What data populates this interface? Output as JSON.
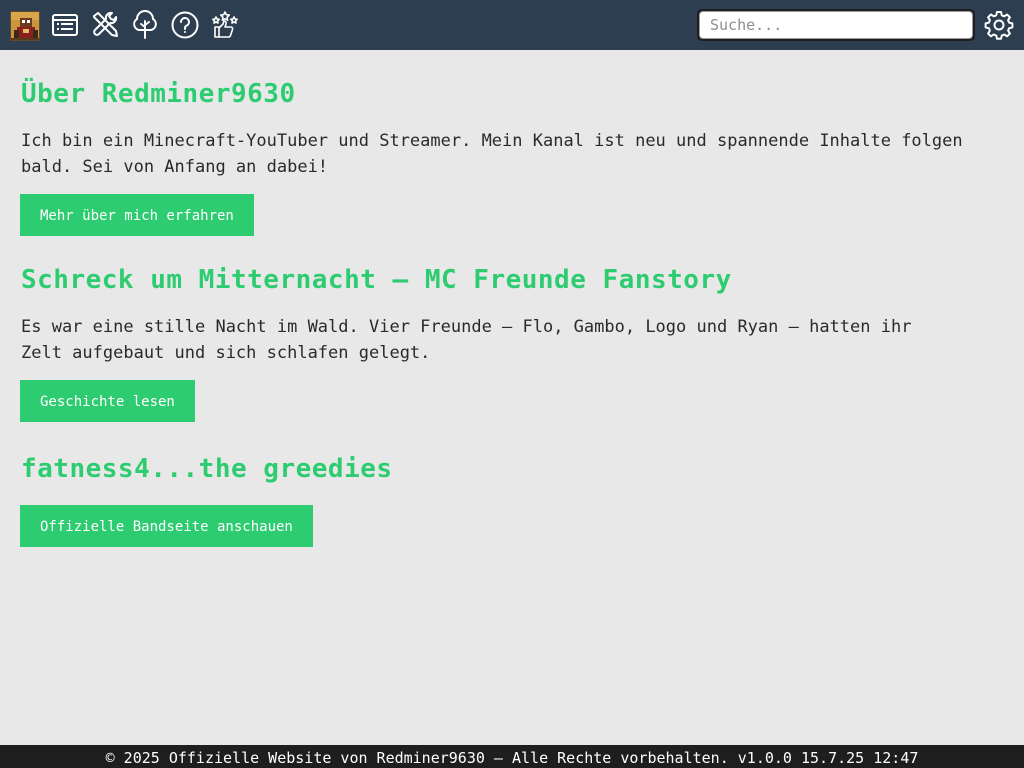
{
  "topbar": {
    "icons": [
      "avatar",
      "list-icon",
      "tools-icon",
      "tree-icon",
      "help-icon",
      "stars-like-icon"
    ],
    "settings_icon": "gear-icon",
    "search": {
      "placeholder": "Suche...",
      "value": ""
    }
  },
  "sections": [
    {
      "title": "Über Redminer9630",
      "text": "Ich bin ein Minecraft-YouTuber und Streamer. Mein Kanal ist neu und spannende Inhalte folgen bald. Sei von Anfang an dabei!",
      "button": "Mehr über mich erfahren"
    },
    {
      "title": "Schreck um Mitternacht – MC Freunde Fanstory",
      "text": "Es war eine stille Nacht im Wald. Vier Freunde – Flo, Gambo, Logo und Ryan – hatten ihr Zelt aufgebaut und sich schlafen gelegt.",
      "button": "Geschichte lesen"
    },
    {
      "title": "fatness4...the greedies",
      "button": "Offizielle Bandseite anschauen"
    }
  ],
  "footer": {
    "text": "© 2025 Offizielle Website von Redminer9630 – Alle Rechte vorbehalten. v1.0.0 15.7.25 12:47"
  },
  "colors": {
    "topbar": "#2c3e50",
    "accent": "#2ecc71",
    "background": "#e8e8e8",
    "footer": "#1e1e1e"
  }
}
